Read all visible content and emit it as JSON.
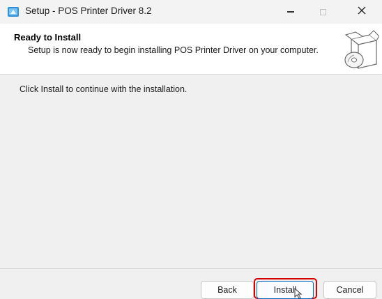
{
  "window": {
    "title": "Setup - POS Printer Driver 8.2",
    "icons": {
      "app": "setup-app-icon",
      "minimize": "minimize-icon",
      "maximize": "maximize-icon",
      "close": "close-icon"
    },
    "close_glyph": "✕"
  },
  "header": {
    "title": "Ready to Install",
    "subtitle": "Setup is now ready to begin installing POS Printer Driver on your computer.",
    "graphic": "install-box-disc-icon"
  },
  "main": {
    "instruction": "Click Install to continue with the installation."
  },
  "footer": {
    "back_label": "Back",
    "install_label": "Install",
    "cancel_label": "Cancel",
    "highlight_color": "#d40000"
  }
}
